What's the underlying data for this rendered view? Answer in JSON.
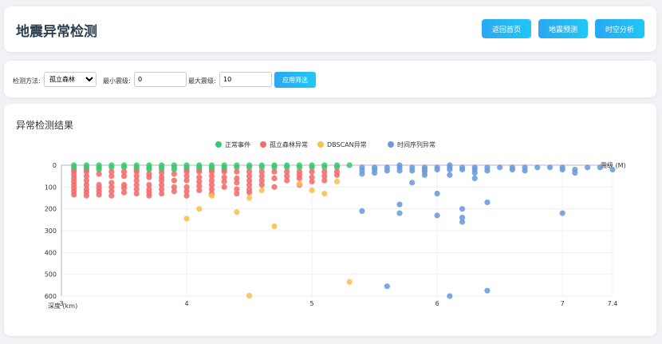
{
  "header": {
    "title": "地震异常检测",
    "buttons": {
      "home": "返回首页",
      "predict": "地震预测",
      "spacetime": "时空分析"
    }
  },
  "filter": {
    "method_label": "检测方法:",
    "method_value": "孤立森林",
    "min_label": "最小震级:",
    "min_value": "0",
    "max_label": "最大震级:",
    "max_value": "10",
    "apply_label": "应用筛选"
  },
  "results": {
    "title": "异常检测结果"
  },
  "chart_data": {
    "type": "scatter",
    "xlabel": "震级 (M)",
    "ylabel": "深度 (km)",
    "xlim": [
      3,
      7.4
    ],
    "ylim": [
      0,
      600
    ],
    "y_inverted": true,
    "x_ticks": [
      "3",
      "4",
      "5",
      "6",
      "7",
      "7.4"
    ],
    "y_ticks": [
      "0",
      "100",
      "200",
      "300",
      "400",
      "500",
      "600"
    ],
    "legend_position": "top-center",
    "grid": true,
    "series": [
      {
        "name": "正常事件",
        "color": "#3cc872",
        "points": [
          [
            3.1,
            0
          ],
          [
            3.2,
            0
          ],
          [
            3.3,
            0
          ],
          [
            3.4,
            0
          ],
          [
            3.5,
            0
          ],
          [
            3.6,
            0
          ],
          [
            3.7,
            0
          ],
          [
            3.8,
            0
          ],
          [
            3.9,
            0
          ],
          [
            4.0,
            0
          ],
          [
            4.1,
            0
          ],
          [
            4.2,
            0
          ],
          [
            4.3,
            0
          ],
          [
            4.4,
            0
          ],
          [
            4.5,
            0
          ],
          [
            4.6,
            0
          ],
          [
            4.7,
            0
          ],
          [
            4.8,
            0
          ],
          [
            4.9,
            0
          ],
          [
            5.0,
            0
          ],
          [
            5.1,
            0
          ],
          [
            5.2,
            0
          ],
          [
            5.3,
            0
          ],
          [
            3.1,
            10
          ],
          [
            3.2,
            10
          ],
          [
            3.3,
            10
          ],
          [
            3.4,
            10
          ],
          [
            3.5,
            10
          ],
          [
            3.6,
            10
          ],
          [
            3.7,
            10
          ],
          [
            3.8,
            10
          ],
          [
            3.9,
            10
          ],
          [
            4.0,
            10
          ],
          [
            4.1,
            10
          ],
          [
            4.2,
            10
          ],
          [
            4.3,
            10
          ],
          [
            4.4,
            10
          ],
          [
            4.5,
            10
          ],
          [
            4.6,
            10
          ],
          [
            4.7,
            10
          ],
          [
            4.8,
            10
          ],
          [
            4.9,
            10
          ],
          [
            5.0,
            10
          ],
          [
            5.1,
            10
          ],
          [
            5.2,
            10
          ],
          [
            3.1,
            20
          ],
          [
            3.2,
            20
          ],
          [
            3.3,
            20
          ],
          [
            3.6,
            20
          ],
          [
            3.7,
            20
          ],
          [
            3.8,
            20
          ],
          [
            3.9,
            20
          ],
          [
            4.0,
            20
          ],
          [
            4.1,
            20
          ],
          [
            4.2,
            20
          ],
          [
            4.3,
            20
          ]
        ]
      },
      {
        "name": "孤立森林异常",
        "color": "#f46b6b",
        "points": [
          [
            3.1,
            30
          ],
          [
            3.1,
            45
          ],
          [
            3.1,
            60
          ],
          [
            3.1,
            75
          ],
          [
            3.1,
            90
          ],
          [
            3.1,
            105
          ],
          [
            3.1,
            120
          ],
          [
            3.1,
            135
          ],
          [
            3.2,
            30
          ],
          [
            3.2,
            50
          ],
          [
            3.2,
            70
          ],
          [
            3.2,
            90
          ],
          [
            3.2,
            110
          ],
          [
            3.2,
            125
          ],
          [
            3.2,
            140
          ],
          [
            3.3,
            40
          ],
          [
            3.3,
            90
          ],
          [
            3.3,
            105
          ],
          [
            3.3,
            120
          ],
          [
            3.3,
            135
          ],
          [
            3.4,
            30
          ],
          [
            3.4,
            50
          ],
          [
            3.4,
            80
          ],
          [
            3.4,
            100
          ],
          [
            3.4,
            120
          ],
          [
            3.4,
            140
          ],
          [
            3.5,
            30
          ],
          [
            3.5,
            50
          ],
          [
            3.5,
            90
          ],
          [
            3.5,
            105
          ],
          [
            3.5,
            125
          ],
          [
            3.6,
            30
          ],
          [
            3.6,
            50
          ],
          [
            3.6,
            70
          ],
          [
            3.6,
            90
          ],
          [
            3.6,
            110
          ],
          [
            3.6,
            130
          ],
          [
            3.7,
            40
          ],
          [
            3.7,
            55
          ],
          [
            3.7,
            90
          ],
          [
            3.7,
            110
          ],
          [
            3.7,
            125
          ],
          [
            3.7,
            140
          ],
          [
            3.8,
            35
          ],
          [
            3.8,
            55
          ],
          [
            3.8,
            70
          ],
          [
            3.8,
            90
          ],
          [
            3.8,
            110
          ],
          [
            3.8,
            130
          ],
          [
            3.9,
            40
          ],
          [
            3.9,
            70
          ],
          [
            3.9,
            100
          ],
          [
            3.9,
            120
          ],
          [
            4.0,
            30
          ],
          [
            4.0,
            50
          ],
          [
            4.0,
            70
          ],
          [
            4.0,
            100
          ],
          [
            4.0,
            120
          ],
          [
            4.0,
            140
          ],
          [
            4.1,
            30
          ],
          [
            4.1,
            55
          ],
          [
            4.1,
            75
          ],
          [
            4.1,
            95
          ],
          [
            4.1,
            115
          ],
          [
            4.2,
            30
          ],
          [
            4.2,
            50
          ],
          [
            4.2,
            70
          ],
          [
            4.2,
            90
          ],
          [
            4.2,
            110
          ],
          [
            4.2,
            130
          ],
          [
            4.3,
            30
          ],
          [
            4.3,
            55
          ],
          [
            4.3,
            75
          ],
          [
            4.3,
            100
          ],
          [
            4.4,
            30
          ],
          [
            4.4,
            60
          ],
          [
            4.4,
            80
          ],
          [
            4.4,
            110
          ],
          [
            4.4,
            130
          ],
          [
            4.5,
            30
          ],
          [
            4.5,
            50
          ],
          [
            4.5,
            70
          ],
          [
            4.5,
            90
          ],
          [
            4.5,
            110
          ],
          [
            4.5,
            125
          ],
          [
            4.6,
            30
          ],
          [
            4.6,
            50
          ],
          [
            4.6,
            70
          ],
          [
            4.6,
            90
          ],
          [
            4.7,
            30
          ],
          [
            4.7,
            60
          ],
          [
            4.7,
            100
          ],
          [
            4.8,
            30
          ],
          [
            4.8,
            50
          ],
          [
            4.8,
            70
          ],
          [
            4.9,
            30
          ],
          [
            4.9,
            45
          ],
          [
            4.9,
            60
          ],
          [
            4.9,
            90
          ],
          [
            5.0,
            30
          ],
          [
            5.0,
            55
          ],
          [
            5.0,
            75
          ],
          [
            5.1,
            30
          ],
          [
            5.1,
            50
          ],
          [
            5.1,
            70
          ],
          [
            5.2,
            30
          ],
          [
            5.2,
            45
          ]
        ]
      },
      {
        "name": "DBSCAN异常",
        "color": "#fbbf4d",
        "points": [
          [
            4.0,
            245
          ],
          [
            4.1,
            200
          ],
          [
            4.2,
            140
          ],
          [
            4.4,
            215
          ],
          [
            4.5,
            150
          ],
          [
            4.6,
            115
          ],
          [
            4.7,
            280
          ],
          [
            4.9,
            85
          ],
          [
            5.0,
            115
          ],
          [
            5.1,
            130
          ],
          [
            5.2,
            75
          ],
          [
            5.3,
            535
          ],
          [
            4.5,
            598
          ]
        ]
      },
      {
        "name": "时间序列异常",
        "color": "#6b9bdc",
        "points": [
          [
            5.4,
            10
          ],
          [
            5.4,
            25
          ],
          [
            5.4,
            40
          ],
          [
            5.4,
            210
          ],
          [
            5.5,
            10
          ],
          [
            5.5,
            20
          ],
          [
            5.5,
            35
          ],
          [
            5.6,
            10
          ],
          [
            5.6,
            25
          ],
          [
            5.6,
            555
          ],
          [
            5.7,
            0
          ],
          [
            5.7,
            10
          ],
          [
            5.7,
            25
          ],
          [
            5.7,
            180
          ],
          [
            5.7,
            220
          ],
          [
            5.8,
            10
          ],
          [
            5.8,
            25
          ],
          [
            5.8,
            80
          ],
          [
            5.9,
            10
          ],
          [
            5.9,
            20
          ],
          [
            5.9,
            30
          ],
          [
            5.9,
            45
          ],
          [
            6.0,
            10
          ],
          [
            6.0,
            20
          ],
          [
            6.0,
            130
          ],
          [
            6.0,
            230
          ],
          [
            6.1,
            0
          ],
          [
            6.1,
            10
          ],
          [
            6.1,
            20
          ],
          [
            6.1,
            45
          ],
          [
            6.1,
            600
          ],
          [
            6.2,
            10
          ],
          [
            6.2,
            20
          ],
          [
            6.2,
            200
          ],
          [
            6.2,
            240
          ],
          [
            6.2,
            260
          ],
          [
            6.3,
            10
          ],
          [
            6.3,
            20
          ],
          [
            6.3,
            35
          ],
          [
            6.3,
            60
          ],
          [
            6.4,
            10
          ],
          [
            6.4,
            25
          ],
          [
            6.4,
            170
          ],
          [
            6.4,
            575
          ],
          [
            6.5,
            10
          ],
          [
            6.6,
            10
          ],
          [
            6.6,
            20
          ],
          [
            6.7,
            10
          ],
          [
            6.7,
            25
          ],
          [
            6.8,
            10
          ],
          [
            6.9,
            10
          ],
          [
            7.0,
            10
          ],
          [
            7.0,
            20
          ],
          [
            7.0,
            220
          ],
          [
            7.1,
            20
          ],
          [
            7.1,
            35
          ],
          [
            7.2,
            10
          ],
          [
            7.3,
            10
          ],
          [
            7.4,
            20
          ]
        ]
      }
    ]
  }
}
